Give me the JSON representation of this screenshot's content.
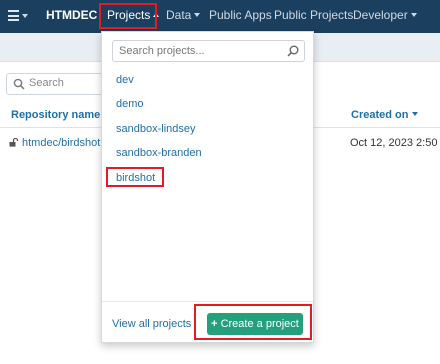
{
  "navbar": {
    "menu_icon": "hamburger-menu-icon",
    "brand": "HTMDEC",
    "items": [
      {
        "label": "Projects"
      },
      {
        "label": "Data"
      },
      {
        "label": "Public Apps"
      },
      {
        "label": "Public Projects"
      },
      {
        "label": "Developer"
      }
    ]
  },
  "page": {
    "search_placeholder": "Search",
    "columns": {
      "repository": "Repository name",
      "created": "Created on"
    },
    "rows": [
      {
        "repository": "htmdec/birdshot",
        "created": "Oct 12, 2023 2:50"
      }
    ]
  },
  "dropdown": {
    "search_placeholder": "Search projects...",
    "projects": [
      "dev",
      "demo",
      "sandbox-lindsey",
      "sandbox-branden",
      "birdshot"
    ],
    "view_all": "View all projects",
    "create_label": "Create a project",
    "create_icon": "plus-icon"
  },
  "colors": {
    "navbar": "#1b3f5e",
    "accent": "#25a07c",
    "link": "#1f6fa8",
    "highlight": "#e01c24"
  }
}
